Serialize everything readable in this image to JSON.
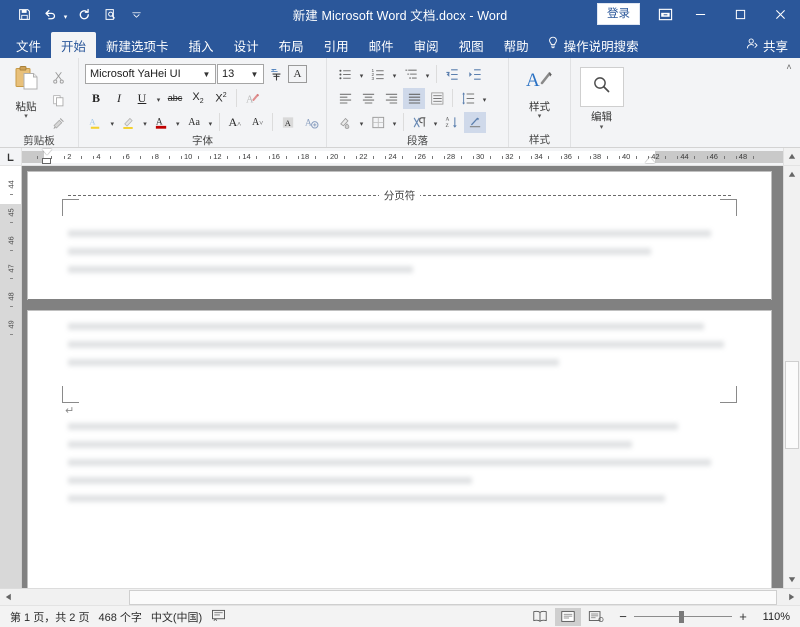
{
  "window": {
    "title": "新建 Microsoft Word 文档.docx  -  Word",
    "signin_label": "登录",
    "quick_access": [
      {
        "name": "save-icon",
        "label": "保存"
      },
      {
        "name": "undo-icon",
        "label": "撤消"
      },
      {
        "name": "redo-icon",
        "label": "恢复"
      },
      {
        "name": "print-preview-icon",
        "label": "打印预览和打印"
      },
      {
        "name": "customize-qat-icon",
        "label": "自定义快速访问工具栏"
      }
    ],
    "ribbon_display_label": "功能区显示选项",
    "minimize_label": "最小化",
    "maximize_label": "最大化",
    "close_label": "关闭"
  },
  "tabs": [
    {
      "label": "文件",
      "active": false
    },
    {
      "label": "开始",
      "active": true
    },
    {
      "label": "新建选项卡",
      "active": false
    },
    {
      "label": "插入",
      "active": false
    },
    {
      "label": "设计",
      "active": false
    },
    {
      "label": "布局",
      "active": false
    },
    {
      "label": "引用",
      "active": false
    },
    {
      "label": "邮件",
      "active": false
    },
    {
      "label": "审阅",
      "active": false
    },
    {
      "label": "视图",
      "active": false
    },
    {
      "label": "帮助",
      "active": false
    }
  ],
  "tell_me": {
    "label": "操作说明搜索",
    "icon": "lightbulb-icon"
  },
  "share": {
    "label": "共享",
    "icon": "share-person-icon"
  },
  "ribbon": {
    "collapse_label": "折叠功能区",
    "clipboard": {
      "label": "剪贴板",
      "paste_label": "粘贴",
      "buttons": [
        {
          "name": "cut-icon",
          "label": "剪切"
        },
        {
          "name": "copy-icon",
          "label": "复制"
        },
        {
          "name": "format-painter-icon",
          "label": "格式刷"
        }
      ]
    },
    "font": {
      "label": "字体",
      "font_name": "Microsoft YaHei UI",
      "font_size": "13",
      "buttons_row1": [
        {
          "name": "phonetic-guide-icon",
          "label": "拼音指南"
        },
        {
          "name": "character-border-icon",
          "label": "字符边框",
          "glyph": "A"
        }
      ],
      "buttons_row2": [
        {
          "name": "bold-icon",
          "label": "加粗",
          "glyph": "B"
        },
        {
          "name": "italic-icon",
          "label": "倾斜",
          "glyph": "I"
        },
        {
          "name": "underline-icon",
          "label": "下划线",
          "glyph": "U"
        },
        {
          "name": "strikethrough-icon",
          "label": "删除线",
          "glyph": "abc"
        },
        {
          "name": "subscript-icon",
          "label": "下标",
          "glyph": "X"
        },
        {
          "name": "superscript-icon",
          "label": "上标",
          "glyph": "X"
        },
        {
          "name": "text-effects-icon",
          "label": "文本效果和版式"
        }
      ],
      "buttons_row3": [
        {
          "name": "text-highlight-color-icon",
          "label": "文本突出显示颜色"
        },
        {
          "name": "font-color-icon",
          "label": "字体颜色",
          "glyph": "A"
        },
        {
          "name": "change-case-icon",
          "label": "更改大小写",
          "glyph": "Aa"
        },
        {
          "name": "grow-font-icon",
          "label": "增大字号",
          "glyph": "A"
        },
        {
          "name": "shrink-font-icon",
          "label": "减小字号",
          "glyph": "A"
        },
        {
          "name": "character-shading-icon",
          "label": "字符底纹",
          "glyph": "A"
        },
        {
          "name": "clear-formatting-icon",
          "label": "清除所有格式"
        }
      ]
    },
    "paragraph": {
      "label": "段落",
      "buttons_row1": [
        {
          "name": "bullets-icon",
          "label": "项目符号"
        },
        {
          "name": "numbering-icon",
          "label": "编号"
        },
        {
          "name": "multilevel-list-icon",
          "label": "多级列表"
        },
        {
          "name": "decrease-indent-icon",
          "label": "减少缩进量"
        },
        {
          "name": "increase-indent-icon",
          "label": "增加缩进量"
        }
      ],
      "buttons_row2": [
        {
          "name": "align-left-icon",
          "label": "左对齐"
        },
        {
          "name": "align-center-icon",
          "label": "居中"
        },
        {
          "name": "align-right-icon",
          "label": "右对齐"
        },
        {
          "name": "justify-icon",
          "label": "两端对齐",
          "active": true
        },
        {
          "name": "distribute-icon",
          "label": "分散对齐"
        },
        {
          "name": "line-spacing-icon",
          "label": "行和段落间距"
        }
      ],
      "buttons_row3": [
        {
          "name": "shading-icon",
          "label": "底纹"
        },
        {
          "name": "borders-icon",
          "label": "边框"
        },
        {
          "name": "show-formatting-marks-icon",
          "label": "显示/隐藏编辑标记"
        },
        {
          "name": "sort-icon",
          "label": "排序"
        },
        {
          "name": "paragraph-layout-icon",
          "label": "中文版式",
          "active": true
        }
      ]
    },
    "styles": {
      "label": "样式",
      "button_label": "样式",
      "icon": "styles-icon"
    },
    "editing": {
      "label": "编辑",
      "button_label": "编辑",
      "icon": "search-icon"
    }
  },
  "ruler": {
    "tab_stop_icon": "left-tab-stop-icon",
    "horizontal_ticks": [
      "2",
      "4",
      "6",
      "8",
      "10",
      "12",
      "14",
      "16",
      "18",
      "20",
      "22",
      "24",
      "26",
      "28",
      "30",
      "32",
      "34",
      "36",
      "38",
      "40",
      "42",
      "44",
      "46",
      "48"
    ],
    "vertical_ticks": [
      "44",
      "45",
      "46",
      "47",
      "48",
      "49"
    ]
  },
  "document": {
    "page_break_label": "分页符",
    "paragraph_mark": "↵"
  },
  "status": {
    "page_info": "第 1 页，共 2 页",
    "word_count": "468 个字",
    "language": "中文(中国)",
    "proofing_icon": "proofing-errors-icon",
    "views": [
      {
        "name": "read-mode-icon",
        "label": "阅读视图",
        "active": false
      },
      {
        "name": "print-layout-icon",
        "label": "页面视图",
        "active": true
      },
      {
        "name": "web-layout-icon",
        "label": "Web 版式视图",
        "active": false
      }
    ],
    "zoom_out_label": "缩小",
    "zoom_in_label": "放大",
    "zoom_level": "110%"
  },
  "colors": {
    "brand_blue": "#2b579a",
    "ribbon_bg": "#f3f4f6",
    "doc_bg": "#818181",
    "accent_red": "#c00000"
  }
}
